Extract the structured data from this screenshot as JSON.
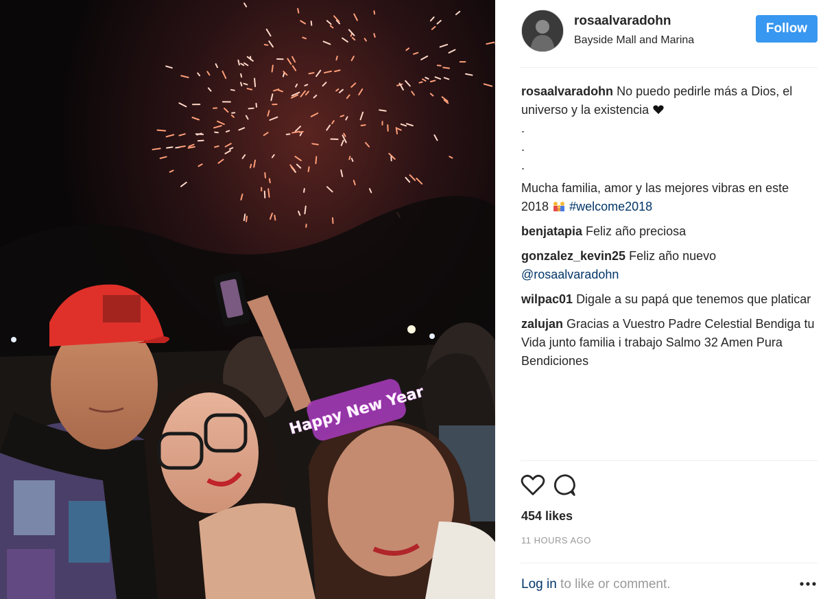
{
  "post": {
    "username": "rosaalvaradohn",
    "location": "Bayside Mall and Marina",
    "follow_label": "Follow",
    "photo_banner": "Happy New Year",
    "caption": {
      "username": "rosaalvaradohn",
      "line1": "No puedo pedirle más a Dios, el universo y la existencia",
      "dots": [
        ".",
        ".",
        "."
      ],
      "line2": "Mucha familia, amor y las mejores vibras en este 2018",
      "hashtag": "#welcome2018"
    },
    "comments": [
      {
        "username": "benjatapia",
        "text": "Feliz año preciosa"
      },
      {
        "username": "gonzalez_kevin25",
        "text": "Feliz año nuevo",
        "mention": "@rosaalvaradohn"
      },
      {
        "username": "wilpac01",
        "text": "Digale a su papá que tenemos que platicar"
      },
      {
        "username": "zalujan",
        "text": "Gracias a Vuestro Padre Celestial Bendiga tu Vida junto familia i trabajo Salmo 32 Amen Pura Bendiciones"
      }
    ],
    "likes": "454 likes",
    "timestamp": "11 HOURS AGO",
    "footer": {
      "login": "Log in",
      "rest": " to like or comment."
    },
    "icons": {
      "like": "heart-outline-icon",
      "comment": "comment-bubble-icon",
      "more": "more-options-icon",
      "caption_emoji": "black-heart-icon"
    },
    "colors": {
      "follow_bg": "#3897f0",
      "link": "#003569",
      "muted": "#999999"
    }
  }
}
